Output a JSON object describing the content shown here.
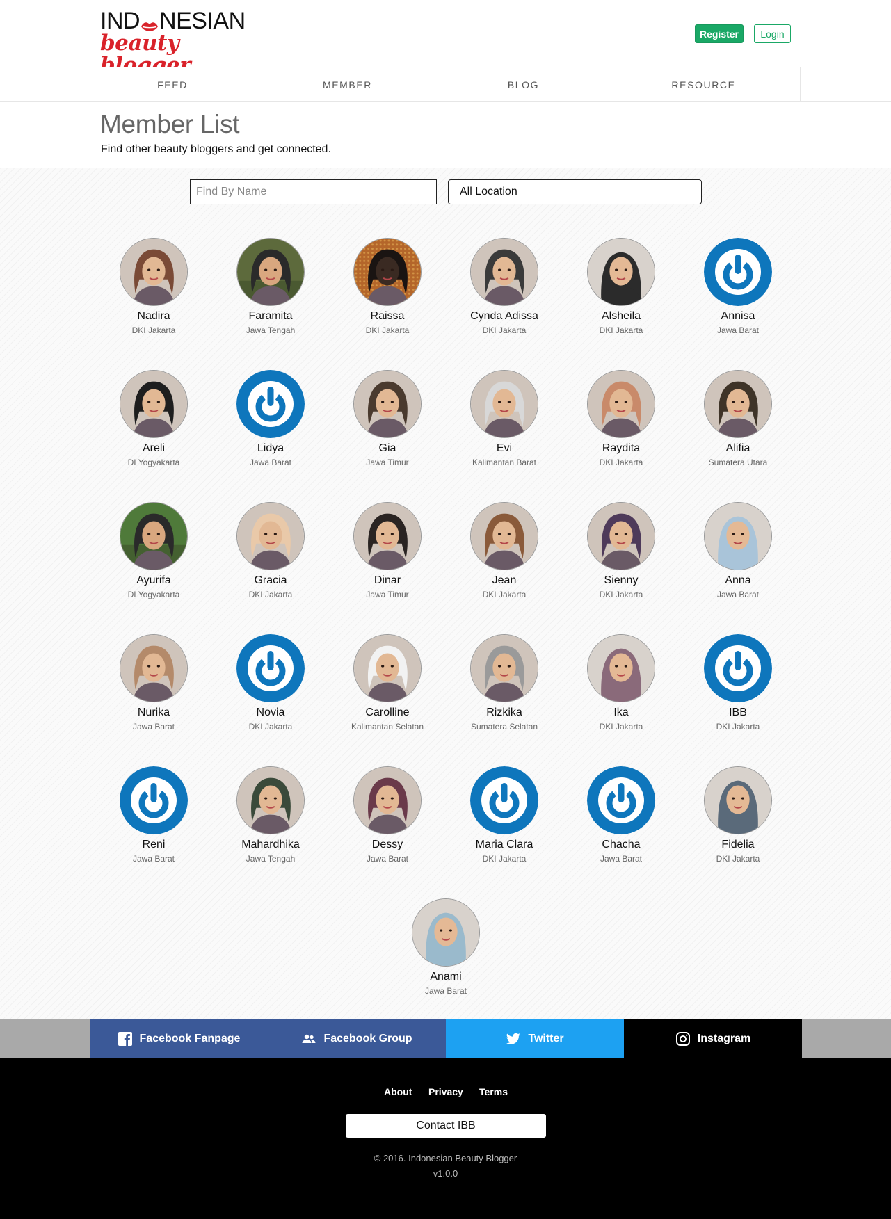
{
  "header": {
    "logo_top_left": "IND",
    "logo_top_right": "NESIAN",
    "logo_bottom": "beauty blogger",
    "register_label": "Register",
    "login_label": "Login"
  },
  "nav": {
    "items": [
      {
        "label": "FEED"
      },
      {
        "label": "MEMBER"
      },
      {
        "label": "BLOG"
      },
      {
        "label": "RESOURCE"
      }
    ]
  },
  "page": {
    "title": "Member List",
    "subtitle": "Find other beauty bloggers and get connected."
  },
  "filters": {
    "search_placeholder": "Find By Name",
    "location_value": "All Location"
  },
  "colors": {
    "brand_red": "#d9222a",
    "register_green": "#1aa866",
    "facebook_blue": "#3b5998",
    "twitter_blue": "#1da1f2",
    "instagram_black": "#000000",
    "default_avatar_blue": "#0e76bc"
  },
  "members": [
    {
      "name": "Nadira",
      "location": "DKI Jakarta",
      "avatar": "photo-portrait",
      "tone": "#7a4a36"
    },
    {
      "name": "Faramita",
      "location": "Jawa Tengah",
      "avatar": "photo-outdoor",
      "tone": "#5d6a3c"
    },
    {
      "name": "Raissa",
      "location": "DKI Jakarta",
      "avatar": "photo-pattern",
      "tone": "#b4662a"
    },
    {
      "name": "Cynda Adissa",
      "location": "DKI Jakarta",
      "avatar": "photo-portrait",
      "tone": "#3a3a3a"
    },
    {
      "name": "Alsheila",
      "location": "DKI Jakarta",
      "avatar": "photo-hijab",
      "tone": "#2b2b2b"
    },
    {
      "name": "Annisa",
      "location": "Jawa Barat",
      "avatar": "default-power-icon",
      "tone": "#0e76bc"
    },
    {
      "name": "Areli",
      "location": "DI Yogyakarta",
      "avatar": "photo-portrait",
      "tone": "#1e1e1e"
    },
    {
      "name": "Lidya",
      "location": "Jawa Barat",
      "avatar": "default-power-icon",
      "tone": "#0e76bc"
    },
    {
      "name": "Gia",
      "location": "Jawa Timur",
      "avatar": "photo-portrait",
      "tone": "#4a3a2e"
    },
    {
      "name": "Evi",
      "location": "Kalimantan Barat",
      "avatar": "photo-portrait",
      "tone": "#d8d8d8"
    },
    {
      "name": "Raydita",
      "location": "DKI Jakarta",
      "avatar": "photo-portrait",
      "tone": "#c98a6a"
    },
    {
      "name": "Alifia",
      "location": "Sumatera Utara",
      "avatar": "photo-portrait",
      "tone": "#3f3428"
    },
    {
      "name": "Ayurifa",
      "location": "DI Yogyakarta",
      "avatar": "photo-outdoor",
      "tone": "#4f7a3a"
    },
    {
      "name": "Gracia",
      "location": "DKI Jakarta",
      "avatar": "photo-portrait",
      "tone": "#e9c9a9"
    },
    {
      "name": "Dinar",
      "location": "Jawa Timur",
      "avatar": "photo-portrait",
      "tone": "#2a2422"
    },
    {
      "name": "Jean",
      "location": "DKI Jakarta",
      "avatar": "photo-portrait",
      "tone": "#8a5a3a"
    },
    {
      "name": "Sienny",
      "location": "DKI Jakarta",
      "avatar": "photo-portrait",
      "tone": "#4e3a5a"
    },
    {
      "name": "Anna",
      "location": "Jawa Barat",
      "avatar": "photo-hijab",
      "tone": "#a9c4d9"
    },
    {
      "name": "Nurika",
      "location": "Jawa Barat",
      "avatar": "photo-portrait",
      "tone": "#b48a6a"
    },
    {
      "name": "Novia",
      "location": "DKI Jakarta",
      "avatar": "default-power-icon",
      "tone": "#0e76bc"
    },
    {
      "name": "Carolline",
      "location": "Kalimantan Selatan",
      "avatar": "photo-portrait",
      "tone": "#f2f2f2"
    },
    {
      "name": "Rizkika",
      "location": "Sumatera Selatan",
      "avatar": "photo-portrait",
      "tone": "#9a9a9a"
    },
    {
      "name": "Ika",
      "location": "DKI Jakarta",
      "avatar": "photo-hijab",
      "tone": "#8a6a7a"
    },
    {
      "name": "IBB",
      "location": "DKI Jakarta",
      "avatar": "default-power-icon",
      "tone": "#0e76bc"
    },
    {
      "name": "Reni",
      "location": "Jawa Barat",
      "avatar": "default-power-icon",
      "tone": "#0e76bc"
    },
    {
      "name": "Mahardhika",
      "location": "Jawa Tengah",
      "avatar": "photo-portrait",
      "tone": "#3a4a3a"
    },
    {
      "name": "Dessy",
      "location": "Jawa Barat",
      "avatar": "photo-portrait",
      "tone": "#6a3a4a"
    },
    {
      "name": "Maria Clara",
      "location": "DKI Jakarta",
      "avatar": "default-power-icon",
      "tone": "#0e76bc"
    },
    {
      "name": "Chacha",
      "location": "Jawa Barat",
      "avatar": "default-power-icon",
      "tone": "#0e76bc"
    },
    {
      "name": "Fidelia",
      "location": "DKI Jakarta",
      "avatar": "photo-hijab",
      "tone": "#5a6a7a"
    },
    {
      "name": "Anami",
      "location": "Jawa Barat",
      "avatar": "photo-hijab",
      "tone": "#9abacc"
    }
  ],
  "social": [
    {
      "label": "Facebook Fanpage",
      "icon": "facebook-icon",
      "color": "#3b5998"
    },
    {
      "label": "Facebook Group",
      "icon": "group-icon",
      "color": "#3b5998"
    },
    {
      "label": "Twitter",
      "icon": "twitter-icon",
      "color": "#1da1f2"
    },
    {
      "label": "Instagram",
      "icon": "instagram-icon",
      "color": "#000000"
    }
  ],
  "footer": {
    "links": [
      {
        "label": "About"
      },
      {
        "label": "Privacy"
      },
      {
        "label": "Terms"
      }
    ],
    "contact_label": "Contact IBB",
    "copyright": "© 2016. Indonesian Beauty Blogger",
    "version": "v1.0.0"
  }
}
